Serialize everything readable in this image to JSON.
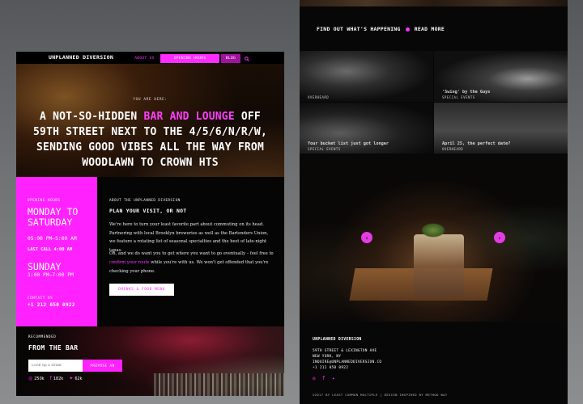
{
  "nav": {
    "brand": "UNPLANNED DIVERSION",
    "about": "ABOUT US",
    "hours": "OPENING HOURS",
    "blog": "BLOG",
    "search_icon": "search-icon"
  },
  "hero": {
    "you_are_here": "YOU ARE HERE:",
    "title_pre": "A NOT-SO-HIDDEN ",
    "title_highlight": "BAR AND LOUNGE",
    "title_post": " OFF 59TH STREET NEXT TO THE 4/5/6/N/R/W, SENDING GOOD VIBES ALL THE WAY FROM WOODLAWN TO CROWN HTS"
  },
  "hours": {
    "label": "OPENING HOURS",
    "days": "MONDAY TO SATURDAY",
    "times": "05:00 PM–5:00 AM",
    "last_call": "LAST CALL 4:00 AM",
    "sunday": "SUNDAY",
    "sunday_times": "1:00 PM–7:00 PM",
    "contact_label": "CONTACT US",
    "phone": "+1 212 050 0922"
  },
  "about": {
    "label": "ABOUT THE UNPLANNED DIVERSION",
    "heading": "PLAN YOUR VISIT, OR NOT",
    "p1": "We're here to turn your least favorite part about commuting on its head. Partnering with local Brooklyn breweries as well as the Bartenders Union, we feature a rotating list of seasonal specialties and the best of late-night tapas.",
    "p2_pre": "Oh, and we do want you to get where you want to go eventually – feel free to ",
    "p2_link": "confirm your route",
    "p2_post": " while you're with us. We won't get offended that you're checking your phone.",
    "menu_button": "DRINKS & FOOD MENU"
  },
  "recommended": {
    "label": "RECOMMENDED",
    "title": "FROM THE BAR",
    "input_placeholder": "Look up a drink",
    "button": "PROPOSE AN",
    "instagram": "250k",
    "facebook": "182k",
    "twitter": "62k"
  },
  "right": {
    "happening": "FIND OUT WHAT'S HAPPENING",
    "read_more": "READ MORE",
    "tiles": [
      {
        "caption": "",
        "sub": "OVERHEARD"
      },
      {
        "caption": "'Swing' by the Guys",
        "sub": "SPECIAL EVENTS"
      },
      {
        "caption": "Your bucket list just got longer",
        "sub": "SPECIAL EVENTS"
      },
      {
        "caption": "April 25, the perfect date?",
        "sub": "OVERHEARD"
      }
    ],
    "prev_icon": "chevron-left-icon",
    "next_icon": "chevron-right-icon"
  },
  "footer": {
    "name": "UNPLANNED DIVERSION",
    "addr1": "59TH STREET & LEXINGTON AVE",
    "addr2": "NEW YORK, NY",
    "email": "INQUIRE@UNPLANNEDDIVERSION.CO",
    "phone": "+1 212 050 0922",
    "credit": "©2017 BY LEAST COMMON MULTIPLE | DESIGN INSPIRED BY METHOD WAY"
  },
  "colors": {
    "accent": "#ff22ff",
    "background": "#050505"
  }
}
